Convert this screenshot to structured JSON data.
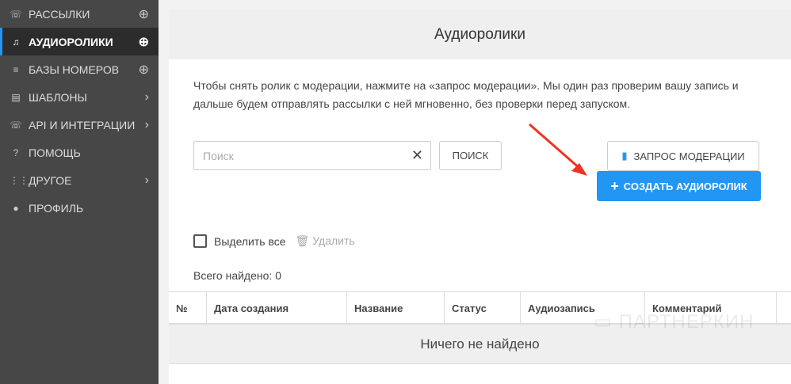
{
  "sidebar": {
    "items": [
      {
        "label": "РАССЫЛКИ",
        "icon": "phone-icon",
        "right": "⊕"
      },
      {
        "label": "АУДИОРОЛИКИ",
        "icon": "music-note-icon",
        "right": "⊕",
        "active": true
      },
      {
        "label": "БАЗЫ НОМЕРОВ",
        "icon": "database-icon",
        "right": "⊕"
      },
      {
        "label": "ШАБЛОНЫ",
        "icon": "document-icon",
        "right": "›"
      },
      {
        "label": "API И ИНТЕГРАЦИИ",
        "icon": "phone-forward-icon",
        "right": "›"
      },
      {
        "label": "ПОМОЩЬ",
        "icon": "question-icon",
        "right": ""
      },
      {
        "label": "ДРУГОЕ",
        "icon": "grid-icon",
        "right": "›"
      },
      {
        "label": "ПРОФИЛЬ",
        "icon": "user-icon",
        "right": ""
      }
    ]
  },
  "page": {
    "title": "Аудиоролики",
    "note": "Чтобы снять ролик с модерации, нажмите на «запрос модерации». Мы один раз проверим вашу запись и дальше будем отправлять рассылки с ней мгновенно, без проверки перед запуском.",
    "search_placeholder": "Поиск",
    "search_button": "ПОИСК",
    "moderation_button": "ЗАПРОС МОДЕРАЦИИ",
    "create_button": "СОЗДАТЬ АУДИОРОЛИК",
    "select_all": "Выделить все",
    "delete": "Удалить",
    "total": "Всего найдено: 0",
    "columns": [
      "№",
      "Дата создания",
      "Название",
      "Статус",
      "Аудиозапись",
      "Комментарий"
    ],
    "empty": "Ничего не найдено",
    "watermark": "ПАРТНЕРКИН"
  }
}
